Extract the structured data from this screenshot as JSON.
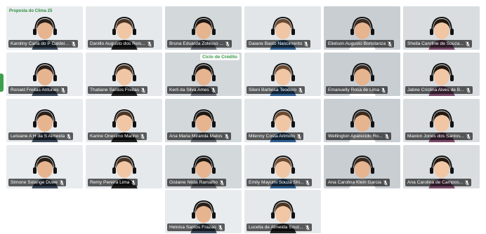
{
  "colors": {
    "tile_bg": "#dfe3e6",
    "namebar": "#000000",
    "name_text": "#ffffff",
    "brand_green": "#3aa04a"
  },
  "tiles": [
    {
      "name": "Karoliny Carla do P Caldeira...",
      "muted": true
    },
    {
      "name": "Danillo Augusto dos Reis...",
      "muted": true
    },
    {
      "name": "Bruna Eduarda Zotesso ...",
      "muted": true
    },
    {
      "name": "Daiane Basto Nascimento",
      "muted": true
    },
    {
      "name": "Elielson Augusto Bortolanza",
      "muted": true
    },
    {
      "name": "Sheila Caroline de Souza...",
      "muted": true
    },
    {
      "name": "Ronald Freitas Antunes",
      "muted": true
    },
    {
      "name": "Thatiane Santos Freitas",
      "muted": true
    },
    {
      "name": "Kerli da Silva Ames",
      "muted": true
    },
    {
      "name": "Sileni Barbosa Teodoro",
      "muted": true
    },
    {
      "name": "Emanuelly Rosa de Lima",
      "muted": true
    },
    {
      "name": "Jabne Cristina Alves de B...",
      "muted": true
    },
    {
      "name": "Leisiane A H da S Almeida",
      "muted": true
    },
    {
      "name": "Karine Onesimo Marino",
      "muted": true
    },
    {
      "name": "Ana Maria Miranda Matos",
      "muted": true
    },
    {
      "name": "Milenny Costa Arimoto",
      "muted": true
    },
    {
      "name": "Wellington Aparecido Ro...",
      "muted": true
    },
    {
      "name": "Maxion Jones dos Santos...",
      "muted": true
    },
    {
      "name": "Simone Solange Duwe",
      "muted": true
    },
    {
      "name": "Remy Pereira Lima",
      "muted": true
    },
    {
      "name": "Gislaine Nilda Ramalho",
      "muted": true
    },
    {
      "name": "Emily Mayumi Souza Shi...",
      "muted": true
    },
    {
      "name": "Ana Carolina Klein Garcia",
      "muted": true
    },
    {
      "name": "Ana Carolina de Campos...",
      "muted": true
    },
    {
      "name": "Heloisa Santos Frazao",
      "muted": true
    },
    {
      "name": "Lucelia de Almeida Souz...",
      "muted": true
    }
  ],
  "banners": {
    "logo_text": "Proposta do Clima 25",
    "ciclo": "Ciclo de Crédito"
  }
}
